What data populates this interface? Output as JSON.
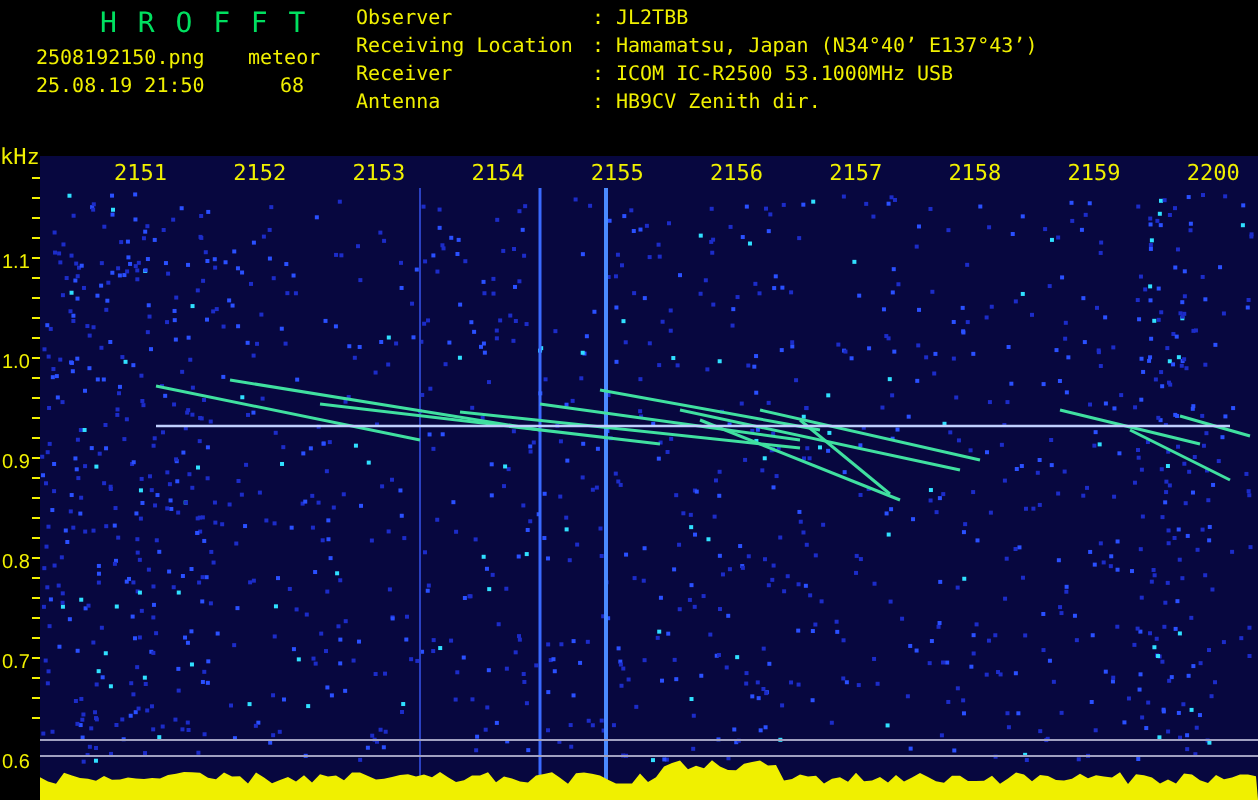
{
  "app_title": "H R O F F T",
  "file_name": "2508192150.png",
  "timestamp": "25.08.19 21:50",
  "meteor_label": "meteor",
  "meteor_count": "68",
  "station_info": [
    {
      "label": "Observer",
      "separator": ":",
      "value": "JL2TBB"
    },
    {
      "label": "Receiving Location",
      "separator": ":",
      "value": "Hamamatsu, Japan (N34°40’ E137°43’)"
    },
    {
      "label": "Receiver",
      "separator": ":",
      "value": "ICOM IC-R2500 53.1000MHz USB"
    },
    {
      "label": "Antenna",
      "separator": ":",
      "value": "HB9CV Zenith dir."
    }
  ],
  "spectrogram": {
    "y_unit": "kHz",
    "x_labels": [
      "2151",
      "2152",
      "2153",
      "2154",
      "2155",
      "2156",
      "2157",
      "2158",
      "2159",
      "2200"
    ],
    "y_labels": [
      "1.1",
      "1.0",
      "0.9",
      "0.8",
      "0.7",
      "0.6"
    ]
  }
}
